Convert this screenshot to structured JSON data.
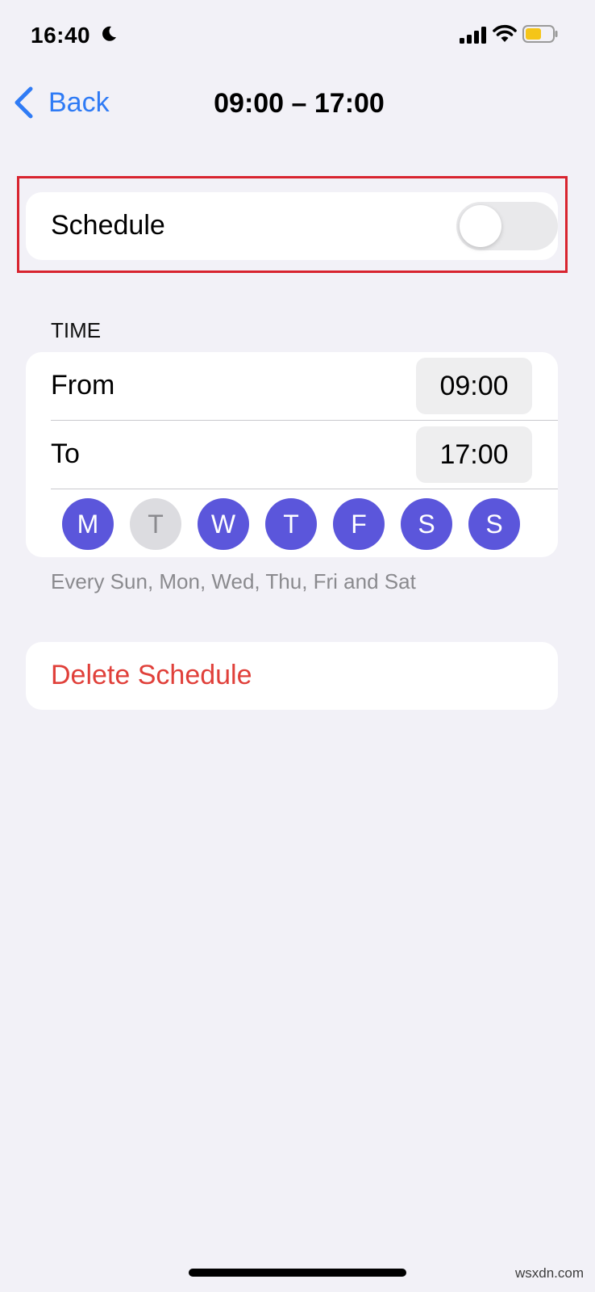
{
  "status_bar": {
    "time": "16:40",
    "icons": [
      "moon-icon",
      "signal-icon",
      "wifi-icon",
      "battery-icon"
    ]
  },
  "nav": {
    "back_label": "Back",
    "title": "09:00 – 17:00"
  },
  "schedule": {
    "label": "Schedule",
    "enabled": false
  },
  "time_section": {
    "header": "TIME",
    "from_label": "From",
    "from_value": "09:00",
    "to_label": "To",
    "to_value": "17:00"
  },
  "days": [
    {
      "letter": "M",
      "selected": true
    },
    {
      "letter": "T",
      "selected": false
    },
    {
      "letter": "W",
      "selected": true
    },
    {
      "letter": "T",
      "selected": true
    },
    {
      "letter": "F",
      "selected": true
    },
    {
      "letter": "S",
      "selected": true
    },
    {
      "letter": "S",
      "selected": true
    }
  ],
  "days_summary": "Every Sun, Mon, Wed, Thu, Fri and Sat",
  "delete_label": "Delete Schedule",
  "watermark": "wsxdn.com",
  "colors": {
    "accent_blue": "#2f7bf5",
    "day_selected": "#5b56db",
    "destructive": "#e0403a",
    "highlight_border": "#d8242f",
    "background": "#f2f1f7"
  }
}
